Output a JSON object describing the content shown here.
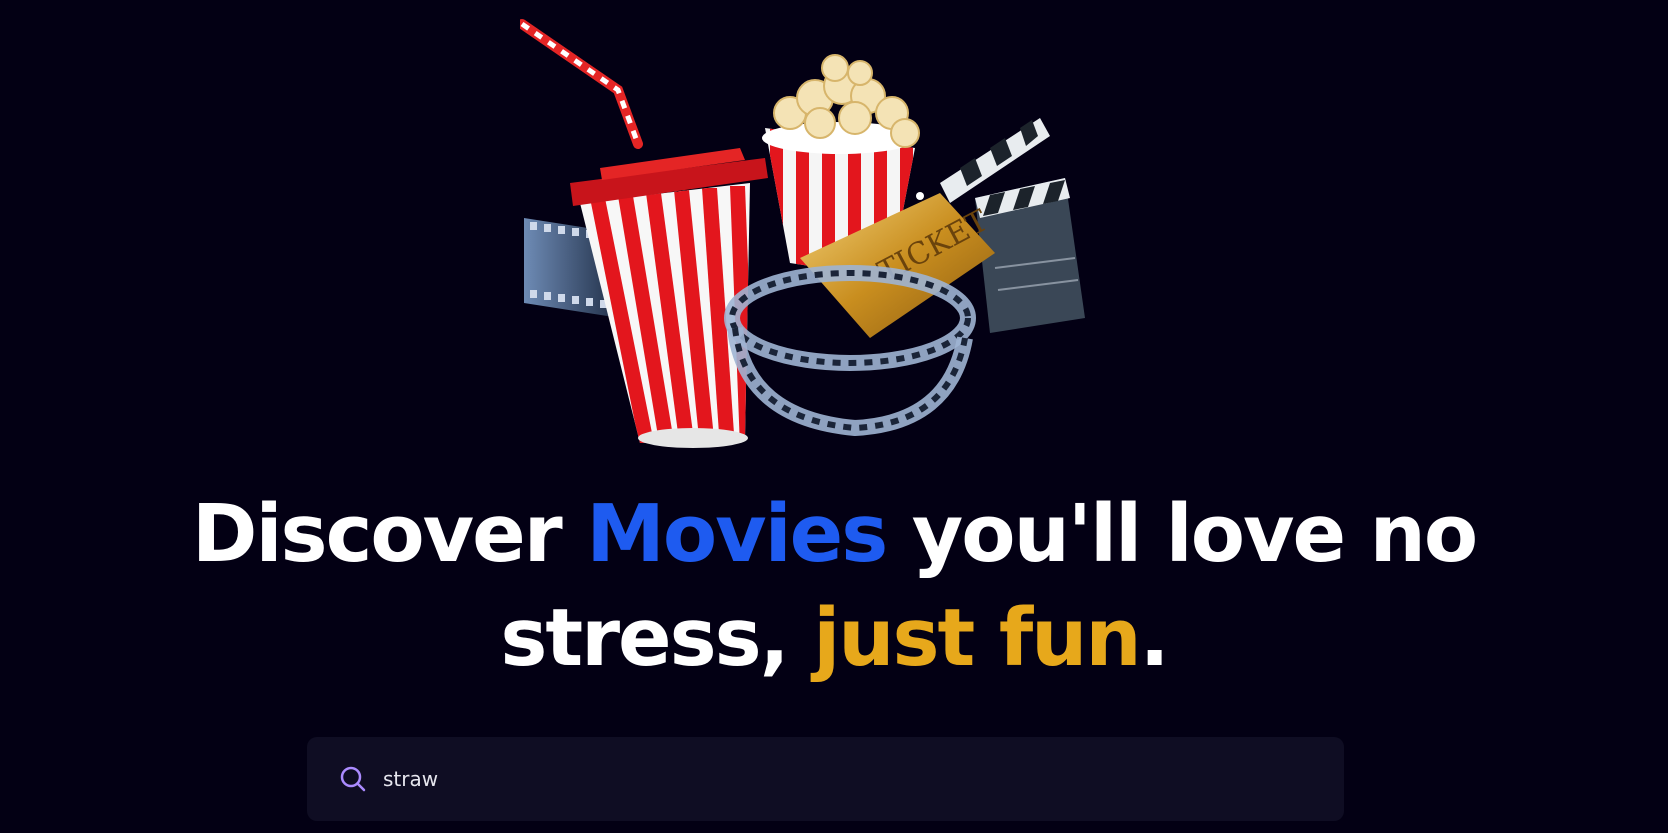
{
  "hero": {
    "image_name": "cinema-snacks-illustration",
    "ticket_text": "TICKET"
  },
  "headline": {
    "part1": "Discover ",
    "highlight1": "Movies",
    "part2": " you'll love no",
    "part3": "stress, ",
    "highlight2": "just fun",
    "part4": "."
  },
  "search": {
    "icon": "search-icon",
    "value": "straw"
  },
  "colors": {
    "background": "#030014",
    "accent_blue": "#1e5bf0",
    "accent_gold": "#e7a81b",
    "search_bg": "#0f0d23",
    "search_icon": "#ab8bff"
  }
}
